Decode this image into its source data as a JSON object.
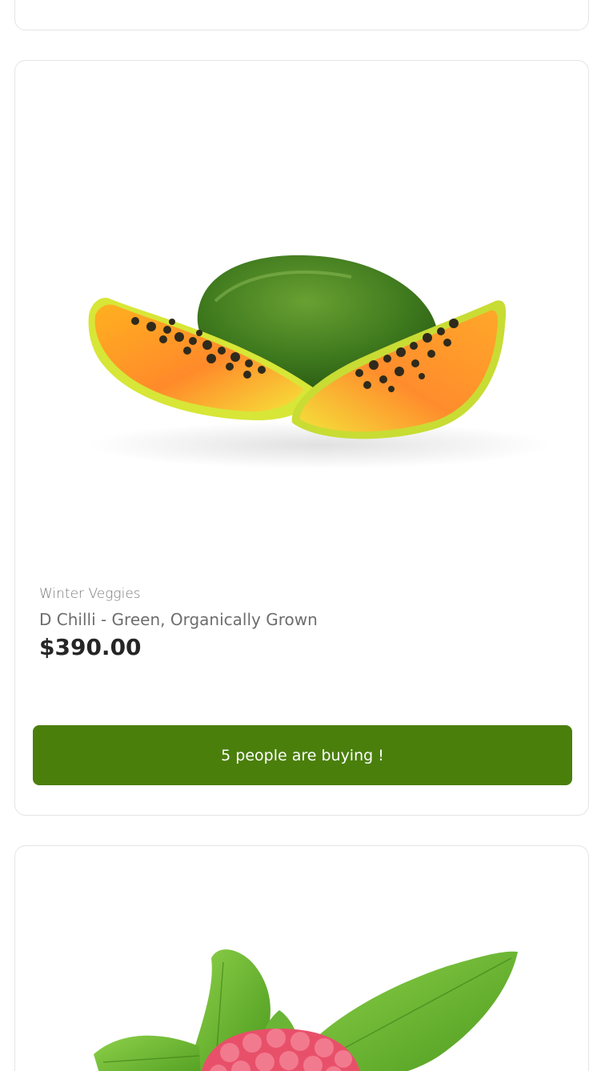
{
  "products": [
    {
      "image_icon": "papaya-image",
      "category": "Winter Veggies",
      "title": "D Chilli - Green, Organically Grown",
      "price": "$390.00",
      "buying_label": "5 people are buying !",
      "button_color": "#4a7f0c"
    },
    {
      "image_icon": "raspberry-image"
    }
  ]
}
